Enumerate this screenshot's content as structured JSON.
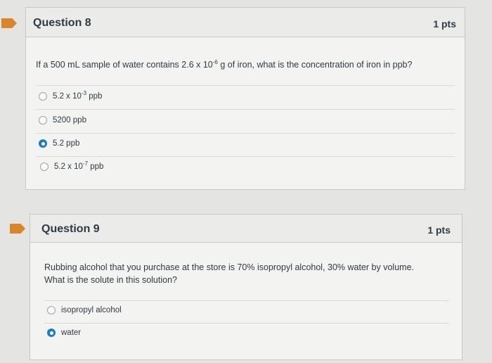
{
  "questions": [
    {
      "title": "Question 8",
      "points": "1 pts",
      "text_before": "If a 500 mL sample of water contains 2.6 x 10",
      "text_sup": "-6",
      "text_after": " g of iron, what is the concentration of iron in ppb?",
      "answers": [
        {
          "base": "5.2 x 10",
          "sup": "-3",
          "unit": " ppb",
          "selected": false
        },
        {
          "base": "5200 ppb",
          "sup": "",
          "unit": "",
          "selected": false
        },
        {
          "base": "5.2 ppb",
          "sup": "",
          "unit": "",
          "selected": true
        },
        {
          "base": "5.2 x 10",
          "sup": "-7",
          "unit": " ppb",
          "selected": false
        }
      ]
    },
    {
      "title": "Question 9",
      "points": "1 pts",
      "text_line1": "Rubbing alcohol that you purchase at the store is 70% isopropyl alcohol, 30% water by volume.",
      "text_line2": "What is the solute in this solution?",
      "answers": [
        {
          "label": "isopropyl alcohol",
          "selected": false
        },
        {
          "label": "water",
          "selected": true
        }
      ]
    }
  ],
  "colors": {
    "flag": "#d9862a",
    "radio_selected": "#1a7fc2",
    "text": "#2d3b45"
  }
}
